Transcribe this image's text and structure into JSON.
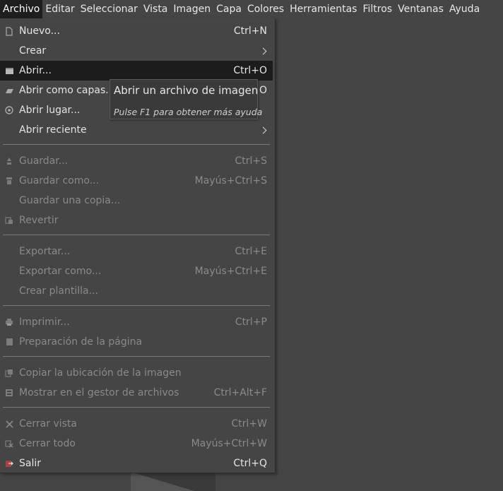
{
  "menubar": {
    "items": [
      "Archivo",
      "Editar",
      "Seleccionar",
      "Vista",
      "Imagen",
      "Capa",
      "Colores",
      "Herramientas",
      "Filtros",
      "Ventanas",
      "Ayuda"
    ],
    "active": "Archivo"
  },
  "file_menu": {
    "items": [
      {
        "label": "Nuevo...",
        "shortcut": "Ctrl+N",
        "icon": "new-file-icon",
        "enabled": true
      },
      {
        "label": "Crear",
        "shortcut": "",
        "icon": "",
        "enabled": true,
        "submenu": true
      },
      {
        "label": "Abrir...",
        "shortcut": "Ctrl+O",
        "icon": "open-file-icon",
        "enabled": true,
        "highlighted": true
      },
      {
        "label": "Abrir como capas...",
        "shortcut": "O",
        "icon": "open-as-layers-icon",
        "enabled": true
      },
      {
        "label": "Abrir lugar...",
        "shortcut": "",
        "icon": "open-location-icon",
        "enabled": true
      },
      {
        "label": "Abrir reciente",
        "shortcut": "",
        "icon": "",
        "enabled": true,
        "submenu": true
      },
      {
        "label": "Guardar...",
        "shortcut": "Ctrl+S",
        "icon": "save-icon",
        "enabled": false
      },
      {
        "label": "Guardar como...",
        "shortcut": "Mayús+Ctrl+S",
        "icon": "save-as-icon",
        "enabled": false
      },
      {
        "label": "Guardar una copia...",
        "shortcut": "",
        "icon": "",
        "enabled": false
      },
      {
        "label": "Revertir",
        "shortcut": "",
        "icon": "revert-icon",
        "enabled": false
      },
      {
        "label": "Exportar...",
        "shortcut": "Ctrl+E",
        "icon": "",
        "enabled": false
      },
      {
        "label": "Exportar como...",
        "shortcut": "Mayús+Ctrl+E",
        "icon": "",
        "enabled": false
      },
      {
        "label": "Crear plantilla...",
        "shortcut": "",
        "icon": "",
        "enabled": false
      },
      {
        "label": "Imprimir...",
        "shortcut": "Ctrl+P",
        "icon": "print-icon",
        "enabled": false
      },
      {
        "label": "Preparación de la página",
        "shortcut": "",
        "icon": "page-setup-icon",
        "enabled": false
      },
      {
        "label": "Copiar la ubicación de la imagen",
        "shortcut": "",
        "icon": "copy-location-icon",
        "enabled": false
      },
      {
        "label": "Mostrar en el gestor de archivos",
        "shortcut": "Ctrl+Alt+F",
        "icon": "file-manager-icon",
        "enabled": false
      },
      {
        "label": "Cerrar vista",
        "shortcut": "Ctrl+W",
        "icon": "close-icon",
        "enabled": false
      },
      {
        "label": "Cerrar todo",
        "shortcut": "Mayús+Ctrl+W",
        "icon": "close-all-icon",
        "enabled": false
      },
      {
        "label": "Salir",
        "shortcut": "Ctrl+Q",
        "icon": "quit-icon",
        "enabled": true
      }
    ]
  },
  "tooltip": {
    "title": "Abrir un archivo de imagen",
    "hint": "Pulse F1 para obtener más ayuda"
  }
}
